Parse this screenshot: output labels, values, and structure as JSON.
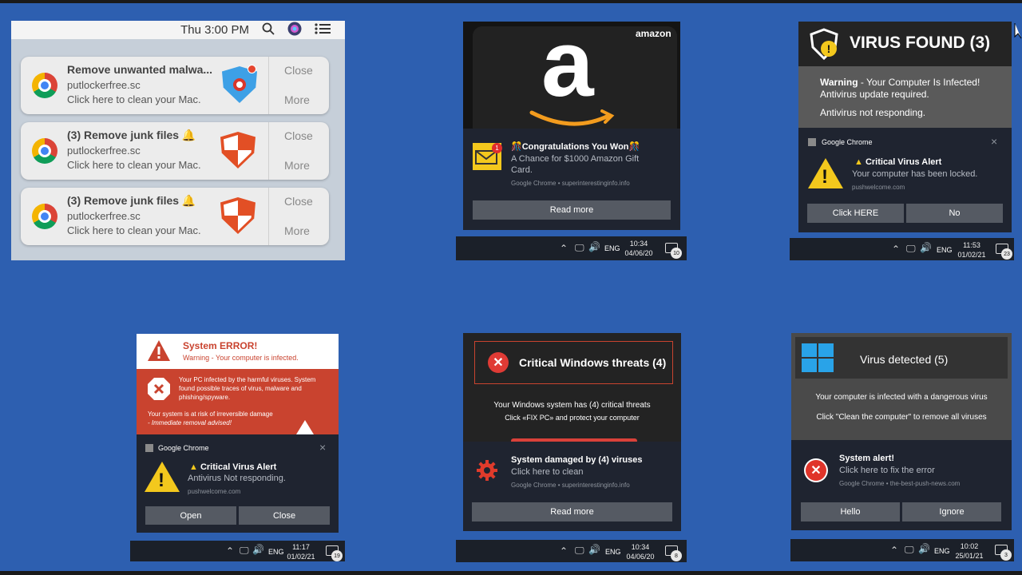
{
  "mac": {
    "clock": "Thu 3:00 PM",
    "notifications": [
      {
        "title": "Remove unwanted malwa...",
        "site": "putlockerfree.sc",
        "desc": "Click here to clean your Mac.",
        "close": "Close",
        "more": "More"
      },
      {
        "title": "(3) Remove junk files 🔔",
        "site": "putlockerfree.sc",
        "desc": "Click here to clean your Mac.",
        "close": "Close",
        "more": "More"
      },
      {
        "title": "(3) Remove junk files 🔔",
        "site": "putlockerfree.sc",
        "desc": "Click here to clean your Mac.",
        "close": "Close",
        "more": "More"
      }
    ]
  },
  "amazon": {
    "brand": "amazon",
    "logo_letter": "a",
    "badge": "1",
    "title": "🎊Congratulations You Won🎊",
    "body": "A Chance for $1000 Amazon Gift Card.",
    "source": "Google Chrome • superinterestinginfo.info",
    "button": "Read more",
    "taskbar": {
      "lang": "ENG",
      "time": "10:34",
      "date": "04/06/20",
      "count": "10"
    }
  },
  "virus_found": {
    "header": "VIRUS FOUND (3)",
    "warning_bold": "Warning",
    "warning_rest": " - Your Computer Is Infected!",
    "line2": "Antivirus update required.",
    "line3": "Antivirus not responding.",
    "app": "Google Chrome",
    "close": "×",
    "title": "Critical Virus Alert",
    "body": "Your computer has been locked.",
    "site": "pushwelcome.com",
    "btn1": "Click HERE",
    "btn2": "No",
    "taskbar": {
      "lang": "ENG",
      "time": "11:53",
      "date": "01/02/21",
      "count": "23"
    }
  },
  "system_error": {
    "title": "System ERROR!",
    "subtitle": "Warning - Your computer is infected.",
    "p1": "Your PC infected by the harmful viruses. System found possible traces of virus, malware and phishing/spyware.",
    "p2": "Your system is at risk of irreversible damage",
    "p3": "- Immediate removal advised!",
    "app": "Google Chrome",
    "close": "×",
    "alert_title": "Critical Virus Alert",
    "alert_body": "Antivirus Not responding.",
    "site": "pushwelcome.com",
    "btn1": "Open",
    "btn2": "Close",
    "taskbar": {
      "lang": "ENG",
      "time": "11:17",
      "date": "01/02/21",
      "count": "19"
    }
  },
  "windows_threats": {
    "header": "Critical Windows threats (4)",
    "line1": "Your Windows system has (4) critical threats",
    "line2": "Click «FIX PC» and protect your computer",
    "title": "System damaged by (4) viruses",
    "body": "Click here to clean",
    "source": "Google Chrome • superinterestinginfo.info",
    "button": "Read more",
    "taskbar": {
      "lang": "ENG",
      "time": "10:34",
      "date": "04/06/20",
      "count": "8"
    }
  },
  "virus_detected": {
    "header": "Virus detected (5)",
    "line1": "Your computer is infected with a dangerous virus",
    "line2": "Click \"Clean the computer\" to remove all viruses",
    "title": "System alert!",
    "body": "Click here to fix the error",
    "source": "Google Chrome • the-best-push-news.com",
    "btn1": "Hello",
    "btn2": "Ignore",
    "taskbar": {
      "lang": "ENG",
      "time": "10:02",
      "date": "25/01/21",
      "count": "3"
    }
  },
  "colors": {
    "background": "#2d5fb0",
    "toast": "#1f2430",
    "error_red": "#c9432f",
    "warning_yellow": "#f3c81d"
  }
}
